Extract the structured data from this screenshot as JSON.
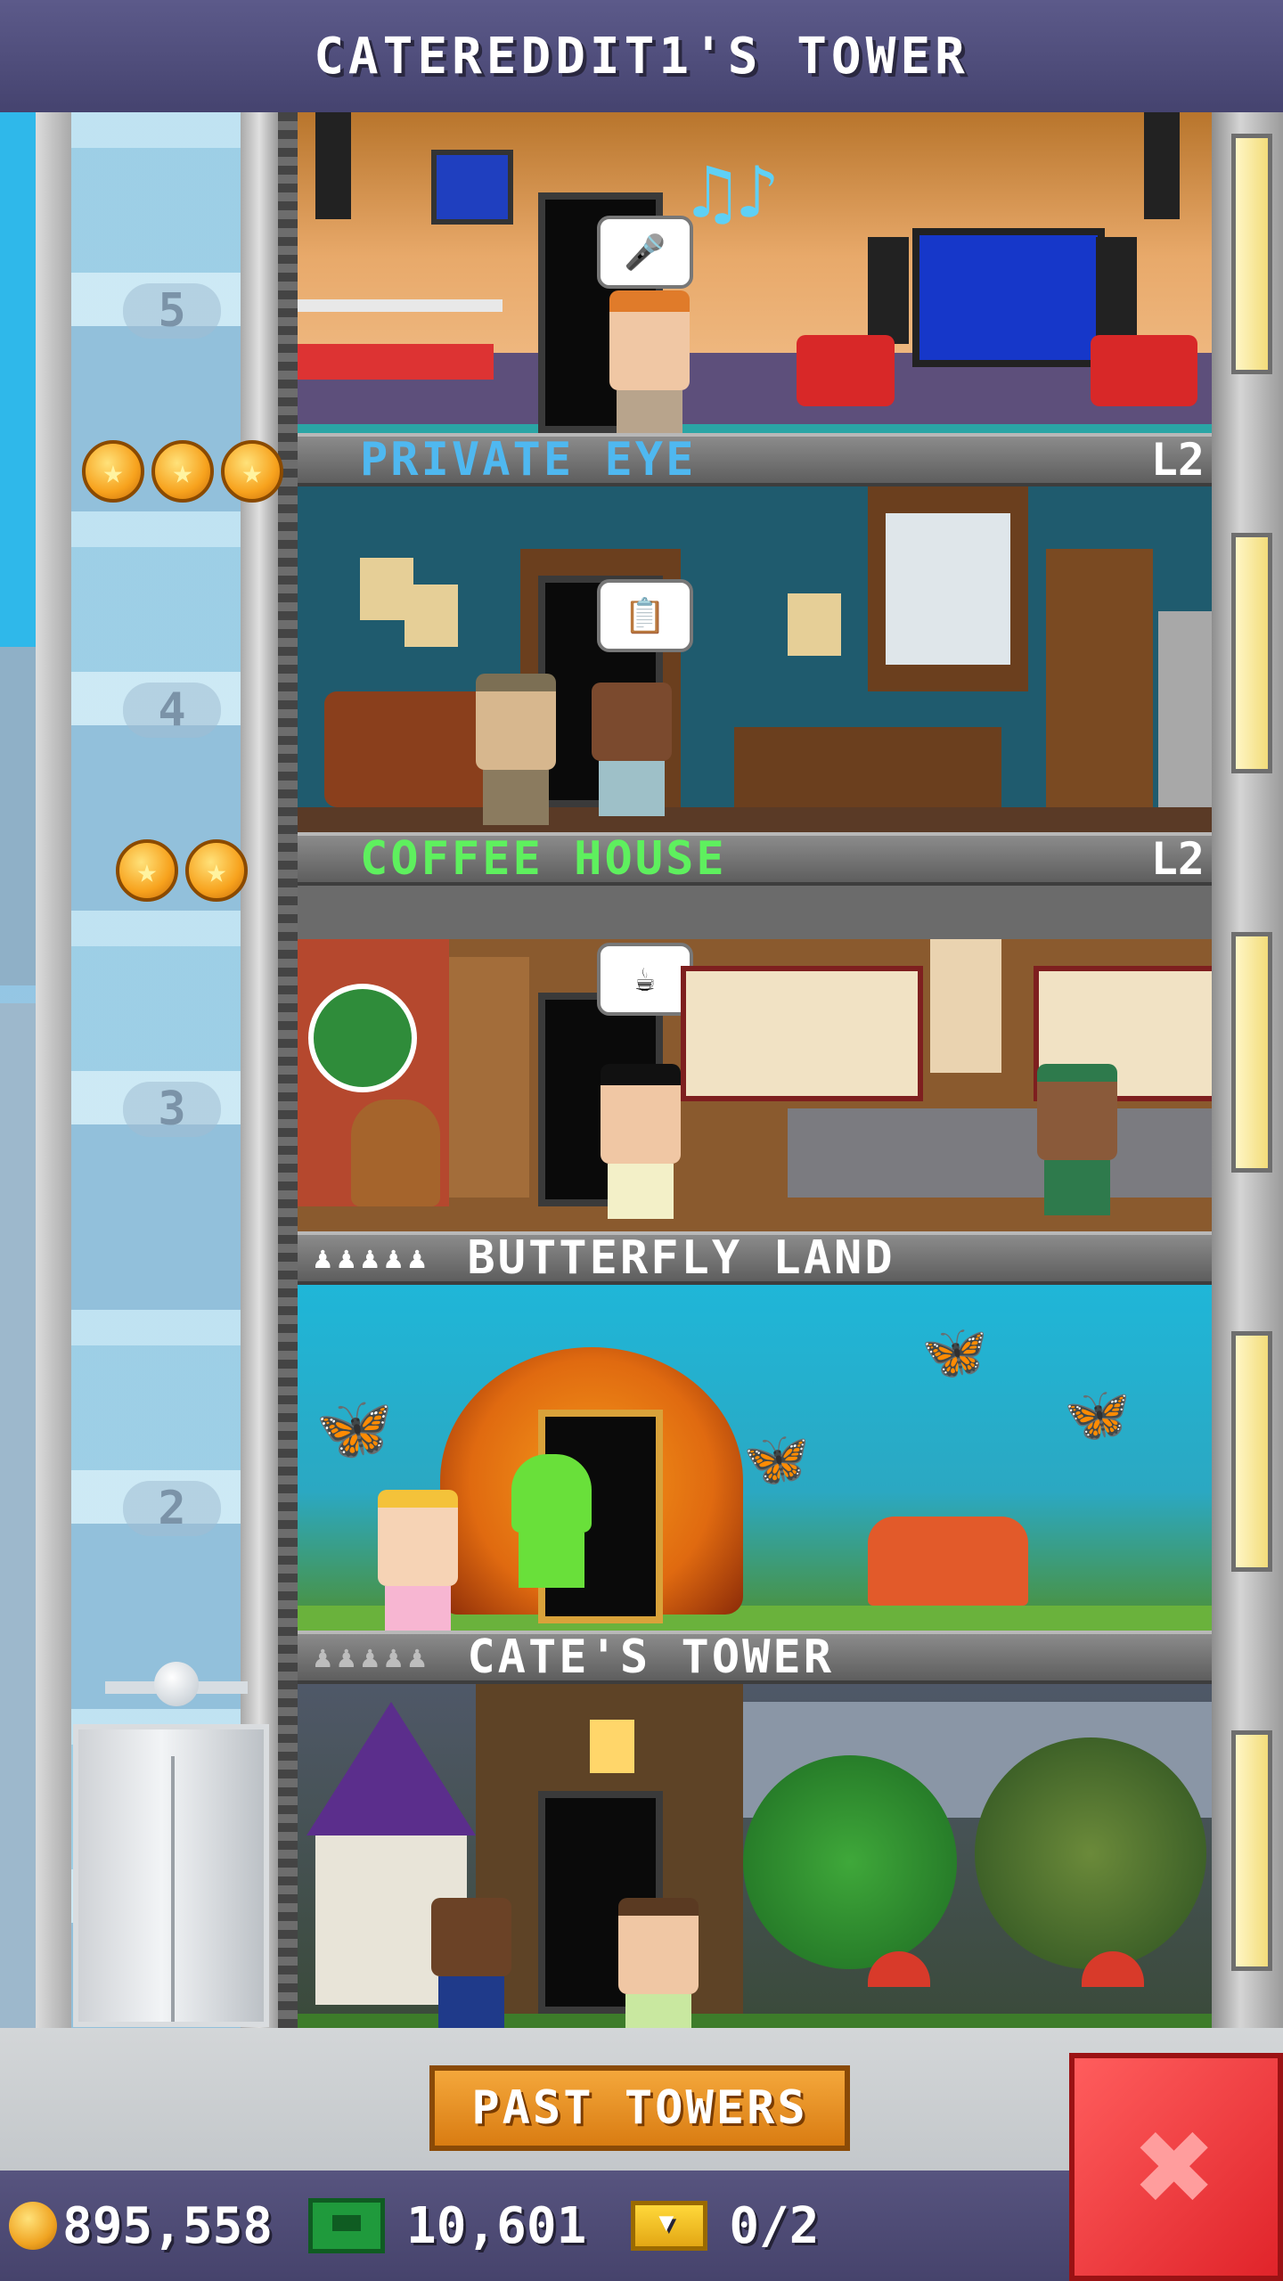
{
  "header": {
    "title": "CATEREDDIT1'S TOWER"
  },
  "elevator": {
    "floor_numbers": [
      "5",
      "4",
      "3",
      "2"
    ]
  },
  "floors": [
    {
      "name": "",
      "type": "music room",
      "level": "",
      "bubble_icon": "microphone-icon"
    },
    {
      "name": "PRIVATE EYE",
      "name_color": "#4fb8f0",
      "level": "L2",
      "stars": 3,
      "bubble_icon": "document-icon"
    },
    {
      "name": "COFFEE HOUSE",
      "name_color": "#5ef05e",
      "level": "L2",
      "stars": 2,
      "bubble_icon": "coffee-cup-icon"
    },
    {
      "name": "BUTTERFLY LAND",
      "name_color": "#ffffff",
      "level": "",
      "residents_icon": "♟♟♟♟♟"
    },
    {
      "name": "CATE'S TOWER",
      "name_color": "#ffffff",
      "level": "",
      "residents_icon": "♟♟♟♟♟"
    }
  ],
  "buttons": {
    "past_towers": "PAST TOWERS",
    "close": "✖"
  },
  "status": {
    "coins": "895,558",
    "bux": "10,601",
    "tickets": "0/2"
  },
  "colors": {
    "header_bg": "#4f4d7c",
    "accent_orange": "#e58b1c",
    "close_red": "#e0242a"
  }
}
